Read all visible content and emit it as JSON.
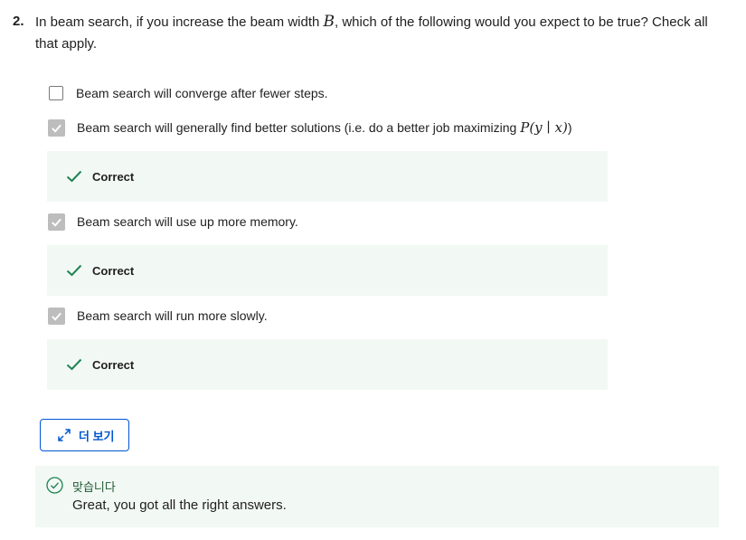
{
  "question": {
    "number": "2.",
    "text_before": "In beam search, if you increase the beam width ",
    "math_var": "B",
    "text_after": ", which of the following would you expect to be true? Check all that apply."
  },
  "options": [
    {
      "label": "Beam search will converge after fewer steps.",
      "checked": false
    },
    {
      "label": "Beam search will generally find better solutions (i.e. do a better job maximizing ",
      "math": "P(y ∣ x)",
      "suffix": ")",
      "checked": true
    },
    {
      "label": "Beam search will use up more memory.",
      "checked": true
    },
    {
      "label": "Beam search will run more slowly.",
      "checked": true
    }
  ],
  "feedback": {
    "correct_label": "Correct"
  },
  "see_more": {
    "label": "더 보기",
    "icon": "expand-arrows-icon"
  },
  "result": {
    "title": "맞습니다",
    "message": "Great, you got all the right answers.",
    "icon": "check-circle-icon"
  },
  "colors": {
    "accent": "#0056d2",
    "success": "#1f8354",
    "feedback_bg": "#f2f8f4",
    "checkbox_checked": "#bdbdbd"
  }
}
